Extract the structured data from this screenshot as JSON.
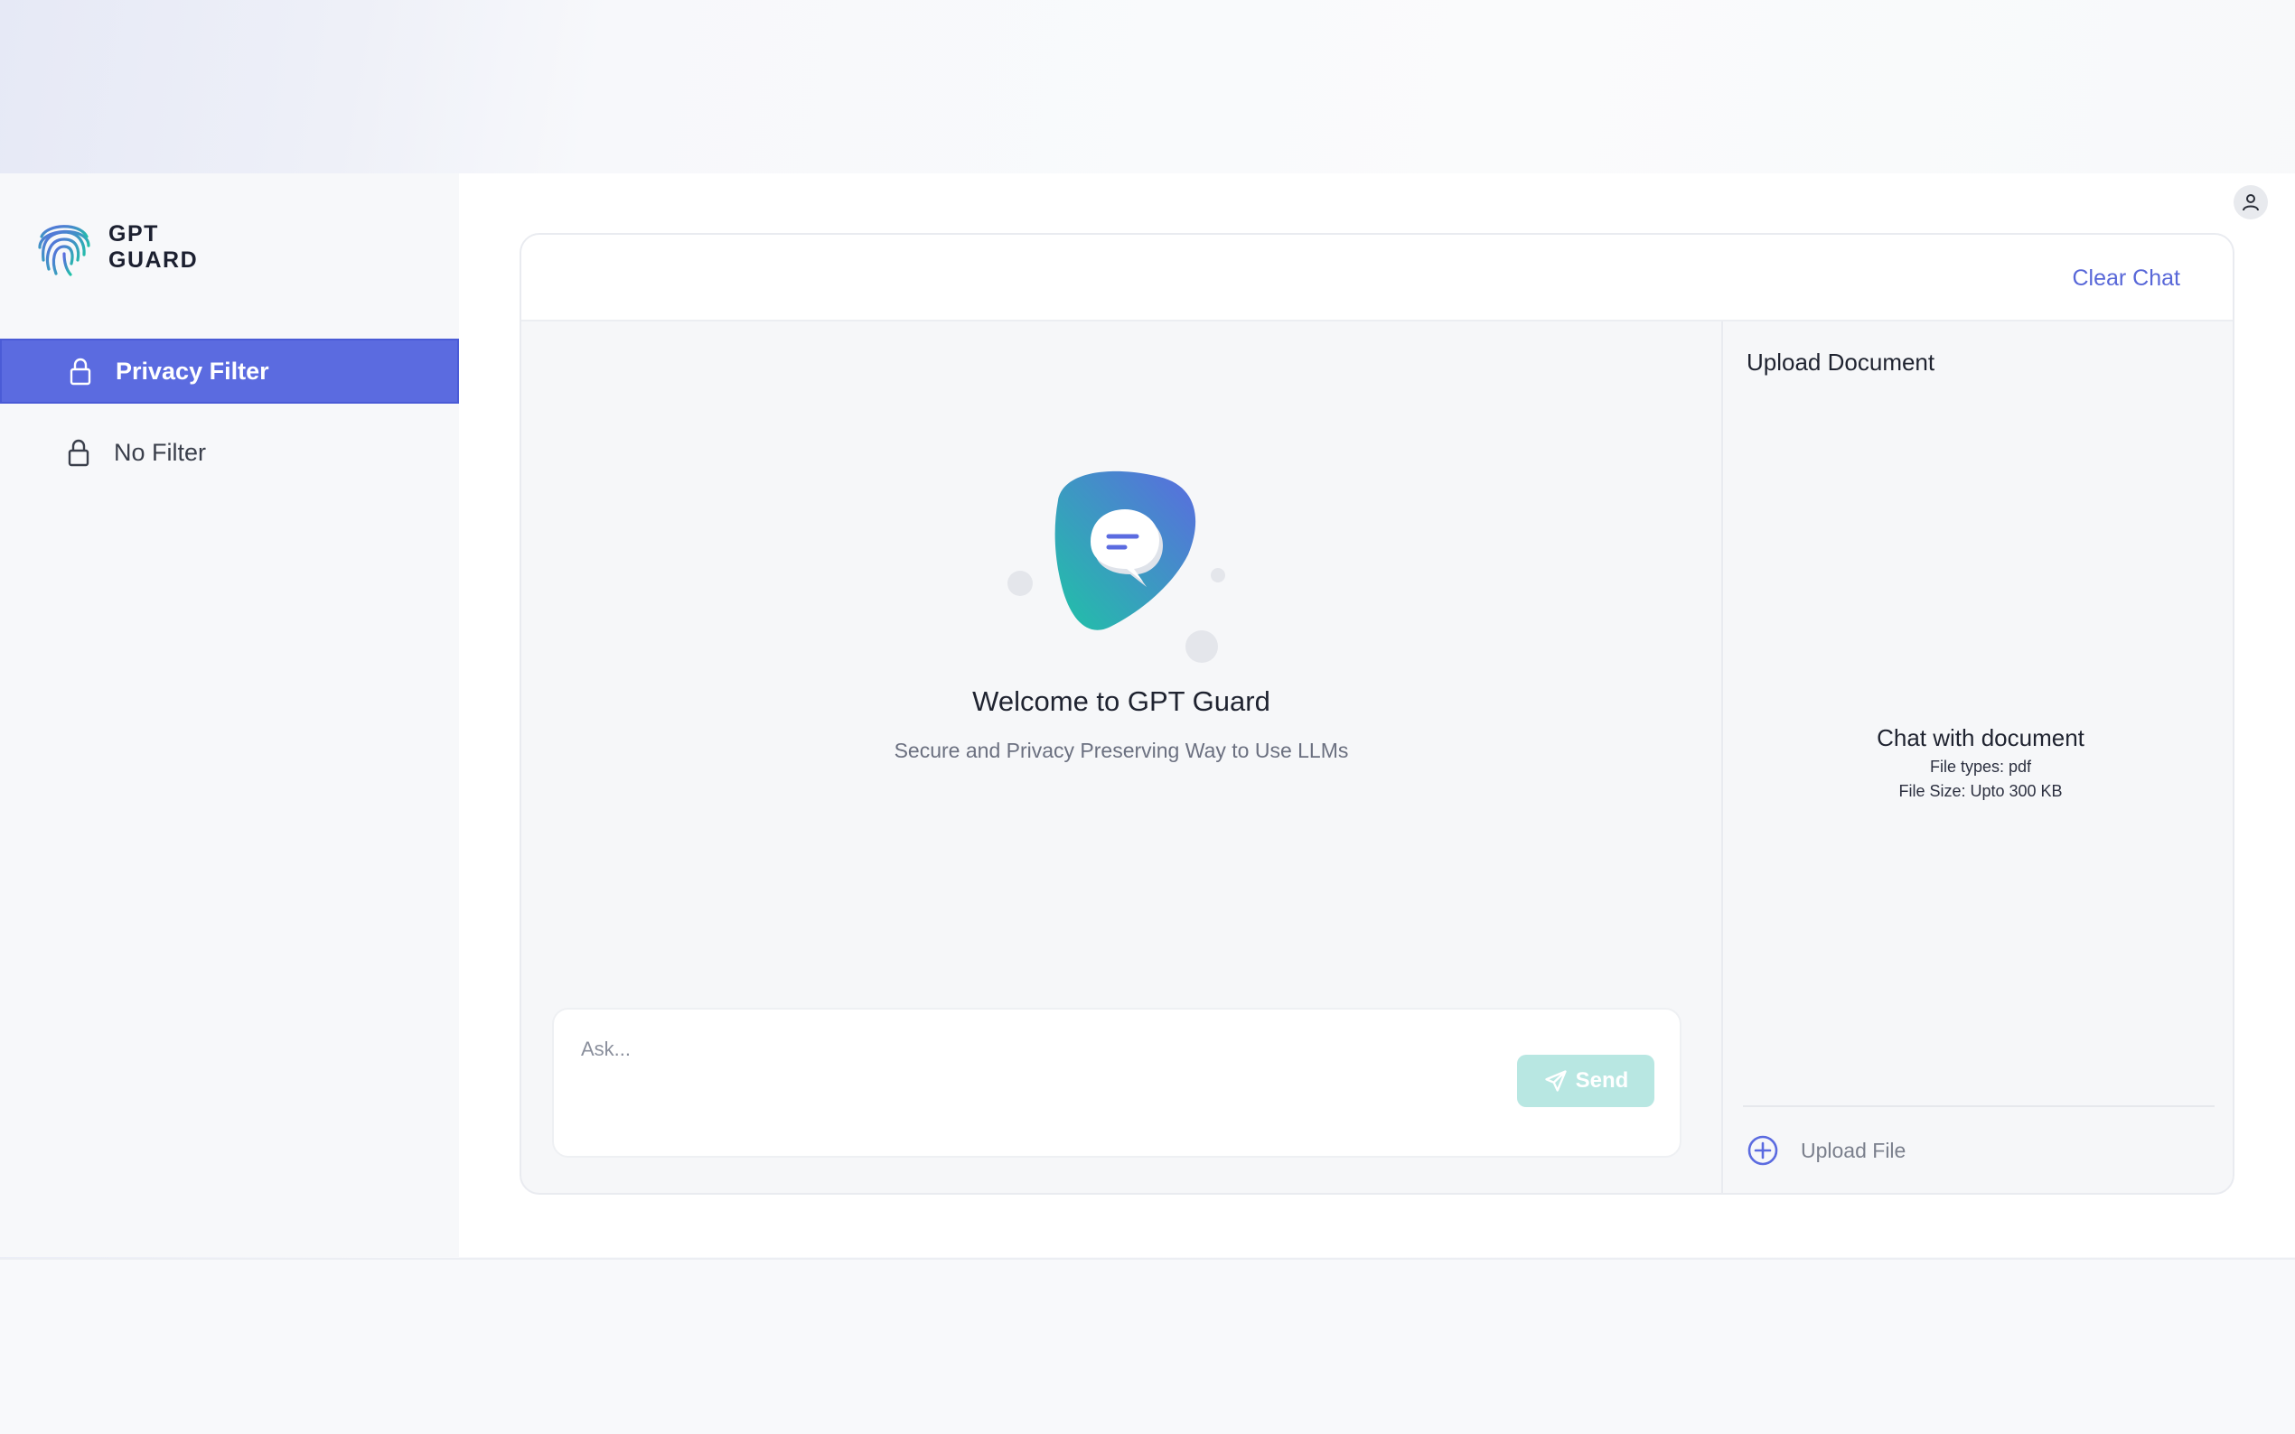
{
  "brand": {
    "line1": "GPT",
    "line2": "GUARD",
    "accent": "#5b6be0"
  },
  "sidebar": {
    "items": [
      {
        "label": "Privacy Filter",
        "icon": "lock-icon",
        "active": true
      },
      {
        "label": "No Filter",
        "icon": "lock-icon",
        "active": false
      }
    ]
  },
  "header": {
    "clear_chat": "Clear Chat",
    "profile_icon": "user-icon"
  },
  "welcome": {
    "title": "Welcome to GPT Guard",
    "subtitle": "Secure and Privacy Preserving Way to Use LLMs"
  },
  "composer": {
    "placeholder": "Ask...",
    "value": "",
    "send_label": "Send"
  },
  "upload": {
    "title": "Upload Document",
    "info_title": "Chat with document",
    "file_types": "File types: pdf",
    "file_size": "File Size: Upto 300 KB",
    "action_label": "Upload File"
  },
  "colors": {
    "primary": "#5b6be0",
    "send_button": "#b8e7e2",
    "link": "#5867d8",
    "gradient_start": "#1fc3a6",
    "gradient_end": "#5b6be0"
  }
}
